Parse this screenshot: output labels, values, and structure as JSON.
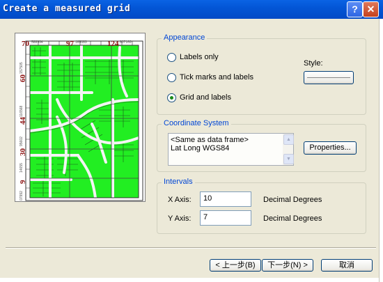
{
  "window": {
    "title": "Create a measured grid",
    "help_glyph": "?",
    "close_glyph": "✕"
  },
  "preview": {
    "top_labels": [
      "70",
      "97",
      "124"
    ],
    "top_sublabels": [
      "588994",
      "165083",
      "807169"
    ],
    "left_labels": [
      "9",
      "30",
      "44",
      "60"
    ],
    "left_sublabels": [
      "07992",
      "14655",
      "95602",
      "116568",
      "157505"
    ],
    "colors": {
      "fill": "#22ee22",
      "line": "#1a5a1a",
      "road": "#f0f0f0",
      "grid": "#444444",
      "label": "#8b1010"
    }
  },
  "appearance": {
    "legend": "Appearance",
    "options": [
      "Labels only",
      "Tick marks and labels",
      "Grid and labels"
    ],
    "selected_index": 2,
    "style_label": "Style:"
  },
  "coordinate_system": {
    "legend": "Coordinate System",
    "line1": "<Same as data frame>",
    "line2": "Lat Long WGS84",
    "properties_button": "Properties..."
  },
  "intervals": {
    "legend": "Intervals",
    "x_label": "X Axis:",
    "x_value": "10",
    "y_label": "Y Axis:",
    "y_value": "7",
    "x_units": "Decimal Degrees",
    "y_units": "Decimal Degrees"
  },
  "buttons": {
    "back": "< 上一步(B)",
    "next": "下一步(N) >",
    "cancel": "取消"
  },
  "theme": {
    "accent": "#0046d5",
    "face": "#ece9d8"
  }
}
